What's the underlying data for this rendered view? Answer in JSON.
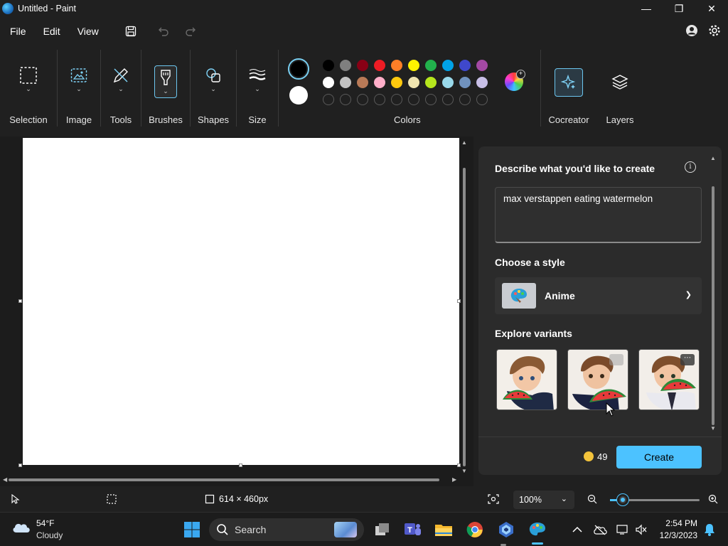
{
  "window": {
    "title": "Untitled - Paint"
  },
  "menu": {
    "file": "File",
    "edit": "Edit",
    "view": "View"
  },
  "ribbon": {
    "selection": "Selection",
    "image": "Image",
    "tools": "Tools",
    "brushes": "Brushes",
    "shapes": "Shapes",
    "size": "Size",
    "colors": "Colors",
    "cocreator": "Cocreator",
    "layers": "Layers",
    "primary_color": "#000000",
    "secondary_color": "#ffffff",
    "palette": [
      "#000000",
      "#7f7f7f",
      "#880015",
      "#ed1c24",
      "#ff7f27",
      "#fff200",
      "#22b14c",
      "#00a2e8",
      "#3f48cc",
      "#a349a4",
      "#ffffff",
      "#c3c3c3",
      "#b97a57",
      "#ffaec9",
      "#ffc90e",
      "#efe4b0",
      "#b5e61d",
      "#99d9ea",
      "#7092be",
      "#c8bfe7"
    ]
  },
  "cocreator": {
    "describe_label": "Describe what you'd like to create",
    "prompt_value": "max verstappen eating watermelon",
    "style_label": "Choose a style",
    "style_value": "Anime",
    "variants_label": "Explore variants",
    "credits": "49",
    "create_label": "Create"
  },
  "status": {
    "canvas_size": "614 × 460px",
    "zoom": "100%",
    "zoom_slider_fraction": 0.14
  },
  "taskbar": {
    "temperature": "54°F",
    "weather": "Cloudy",
    "search_label": "Search",
    "time": "2:54 PM",
    "date": "12/3/2023"
  }
}
